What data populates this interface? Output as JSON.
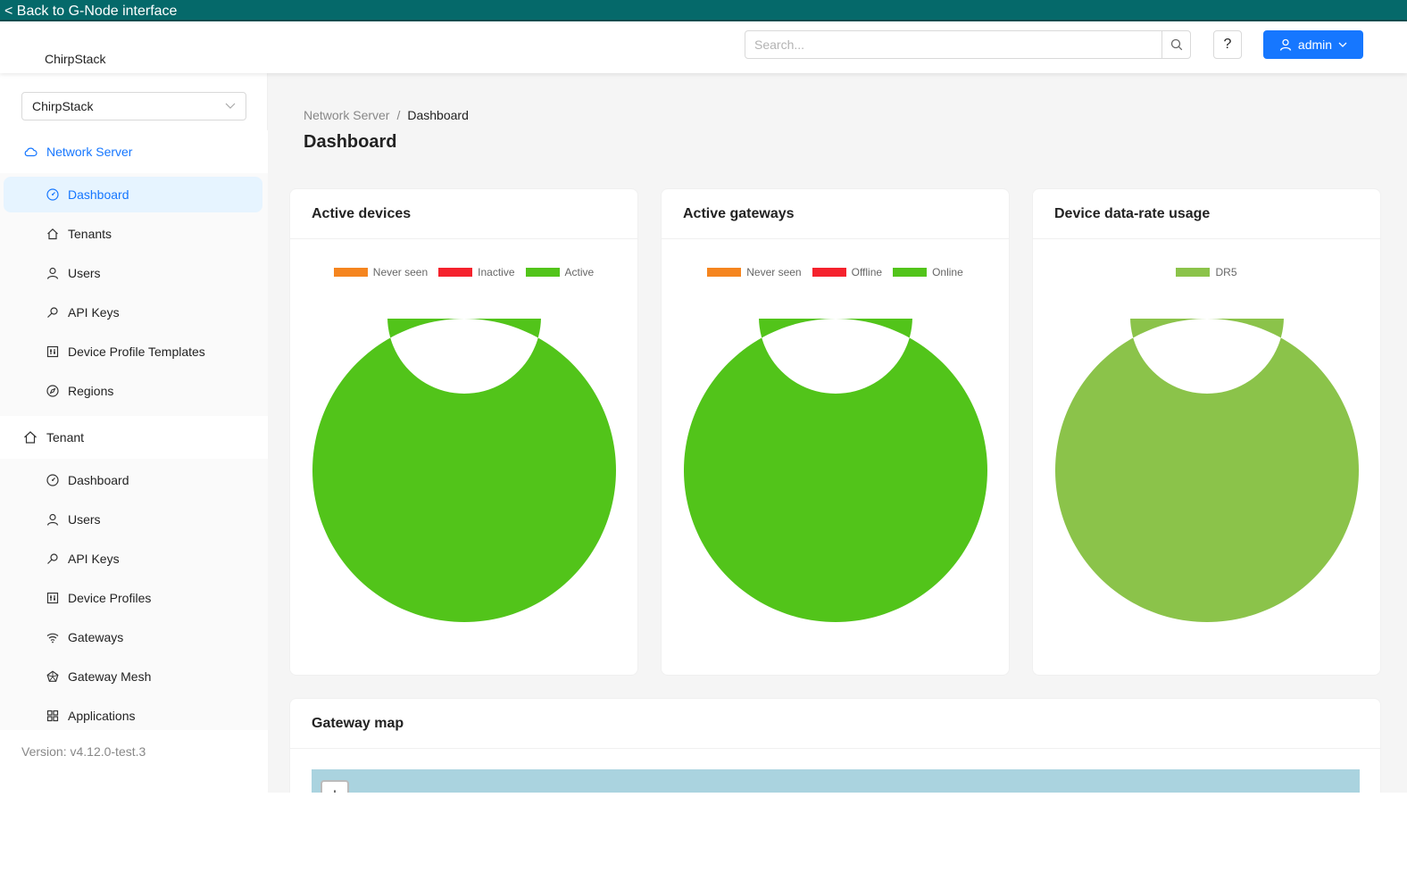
{
  "topbar": {
    "back_link": "< Back to G-Node interface"
  },
  "header": {
    "brand": "ChirpStack",
    "search_placeholder": "Search...",
    "help_label": "?",
    "user_label": "admin"
  },
  "sidebar": {
    "selector_value": "ChirpStack",
    "network_server": {
      "label": "Network Server",
      "items": [
        {
          "label": "Dashboard",
          "icon": "dashboard-icon"
        },
        {
          "label": "Tenants",
          "icon": "home-icon"
        },
        {
          "label": "Users",
          "icon": "user-icon"
        },
        {
          "label": "API Keys",
          "icon": "key-icon"
        },
        {
          "label": "Device Profile Templates",
          "icon": "profile-icon"
        },
        {
          "label": "Regions",
          "icon": "compass-icon"
        }
      ]
    },
    "tenant": {
      "label": "Tenant",
      "items": [
        {
          "label": "Dashboard",
          "icon": "dashboard-icon"
        },
        {
          "label": "Users",
          "icon": "user-icon"
        },
        {
          "label": "API Keys",
          "icon": "key-icon"
        },
        {
          "label": "Device Profiles",
          "icon": "profile-icon"
        },
        {
          "label": "Gateways",
          "icon": "wifi-icon"
        },
        {
          "label": "Gateway Mesh",
          "icon": "mesh-icon"
        },
        {
          "label": "Applications",
          "icon": "apps-icon"
        }
      ]
    },
    "version": "Version: v4.12.0-test.3"
  },
  "main": {
    "breadcrumb": {
      "parent": "Network Server",
      "separator": "/",
      "current": "Dashboard"
    },
    "title": "Dashboard",
    "map_title": "Gateway map",
    "map_zoom_in": "+"
  },
  "colors": {
    "accent": "#1677ff",
    "topbar": "#05696a",
    "never_seen": "#f5851f",
    "inactive": "#f5222d",
    "active": "#52c41a",
    "dr5": "#8bc34a"
  },
  "chart_data": [
    {
      "type": "pie",
      "title": "Active devices",
      "categories": [
        "Never seen",
        "Inactive",
        "Active"
      ],
      "values": [
        0,
        0,
        1
      ],
      "colors": [
        "#f5851f",
        "#f5222d",
        "#52c41a"
      ],
      "legend": "top"
    },
    {
      "type": "pie",
      "title": "Active gateways",
      "categories": [
        "Never seen",
        "Offline",
        "Online"
      ],
      "values": [
        0,
        0,
        1
      ],
      "colors": [
        "#f5851f",
        "#f5222d",
        "#52c41a"
      ],
      "legend": "top"
    },
    {
      "type": "pie",
      "title": "Device data-rate usage",
      "categories": [
        "DR5"
      ],
      "values": [
        1
      ],
      "colors": [
        "#8bc34a"
      ],
      "legend": "top"
    }
  ]
}
